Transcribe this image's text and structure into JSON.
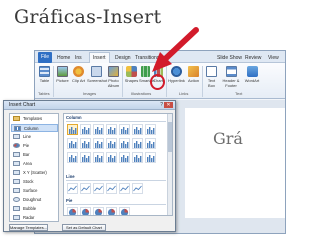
{
  "slide": {
    "title": "Gráficas-Insert"
  },
  "ribbon": {
    "tabs": [
      {
        "label": "File"
      },
      {
        "label": "Home"
      },
      {
        "label": "Ins"
      },
      {
        "label": "Insert"
      },
      {
        "label": "Design"
      },
      {
        "label": "Transitions"
      },
      {
        "label": "Slide Show"
      },
      {
        "label": "Review"
      },
      {
        "label": "View"
      }
    ],
    "buttons": [
      {
        "label": "Table"
      },
      {
        "label": "Picture"
      },
      {
        "label": "Clip Art"
      },
      {
        "label": "Screenshot"
      },
      {
        "label": "Photo Album"
      },
      {
        "label": "Shapes"
      },
      {
        "label": "SmartArt"
      },
      {
        "label": "Chart"
      },
      {
        "label": "Hyperlink"
      },
      {
        "label": "Action"
      },
      {
        "label": "Text Box"
      },
      {
        "label": "Header & Footer"
      },
      {
        "label": "WordArt"
      }
    ],
    "groups": [
      {
        "label": "Tables"
      },
      {
        "label": "Images"
      },
      {
        "label": "Illustrations"
      },
      {
        "label": "Links"
      },
      {
        "label": "Text"
      }
    ]
  },
  "background_text": "Grá",
  "dialog": {
    "title": "Insert Chart",
    "help": "?",
    "close": "✕",
    "categories": [
      {
        "label": "Templates"
      },
      {
        "label": "Column"
      },
      {
        "label": "Line"
      },
      {
        "label": "Pie"
      },
      {
        "label": "Bar"
      },
      {
        "label": "Area"
      },
      {
        "label": "X Y (Scatter)"
      },
      {
        "label": "Stock"
      },
      {
        "label": "Surface"
      },
      {
        "label": "Doughnut"
      },
      {
        "label": "Bubble"
      },
      {
        "label": "Radar"
      }
    ],
    "selected_category": "Column",
    "sections": [
      {
        "label": "Column"
      },
      {
        "label": "Line"
      },
      {
        "label": "Pie"
      }
    ],
    "buttons": {
      "manage_templates": "Manage Templates...",
      "set_default": "Set as Default Chart"
    }
  },
  "colors": {
    "accent_red": "#d21b2b",
    "file_tab": "#2f6fc4",
    "selection": "#cfe1f7"
  },
  "icons": {
    "arrow": "red-arrow-pointer",
    "chart": "chart-icon"
  }
}
